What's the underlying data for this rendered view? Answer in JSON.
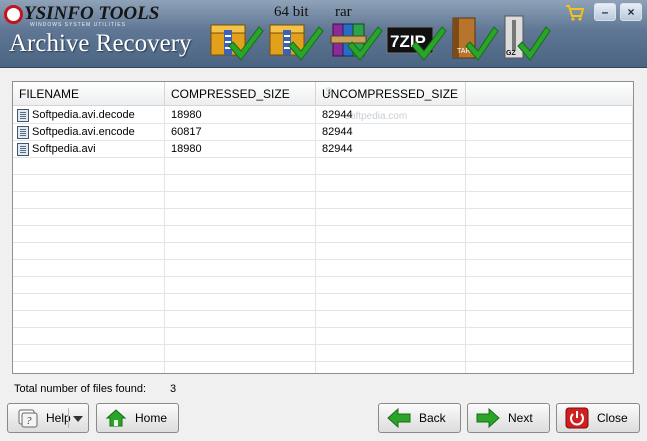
{
  "app": {
    "brand": "YSINFO TOOLS",
    "tagline": "WINDOWS SYSTEM UTILITIES",
    "title": "Archive Recovery"
  },
  "formats": [
    {
      "name": "zip-icon",
      "label": ""
    },
    {
      "name": "zip64-icon",
      "label": "64 bit"
    },
    {
      "name": "rar-icon",
      "label": "rar"
    },
    {
      "name": "7zip-icon",
      "label": "7ZIP"
    },
    {
      "name": "tar-icon",
      "label": "TAR"
    },
    {
      "name": "gz-icon",
      "label": "GZ"
    }
  ],
  "window": {
    "minimize": "–",
    "close": "×"
  },
  "table": {
    "columns": [
      "FILENAME",
      "COMPRESSED_SIZE",
      "UNCOMPRESSED_SIZE",
      ""
    ],
    "rows": [
      {
        "filename": "Softpedia.avi.decode",
        "compressed": "18980",
        "uncompressed": "82944"
      },
      {
        "filename": "Softpedia.avi.encode",
        "compressed": "60817",
        "uncompressed": "82944"
      },
      {
        "filename": "Softpedia.avi",
        "compressed": "18980",
        "uncompressed": "82944"
      }
    ],
    "watermark": "S",
    "watermark2": "softpedia.com"
  },
  "status": {
    "label": "Total number of files found:",
    "count": "3"
  },
  "buttons": {
    "help": "Help",
    "home": "Home",
    "back": "Back",
    "next": "Next",
    "close": "Close"
  },
  "colors": {
    "header": "#5f7794",
    "accent_green": "#2aa52a",
    "close_red": "#d01f1f"
  }
}
